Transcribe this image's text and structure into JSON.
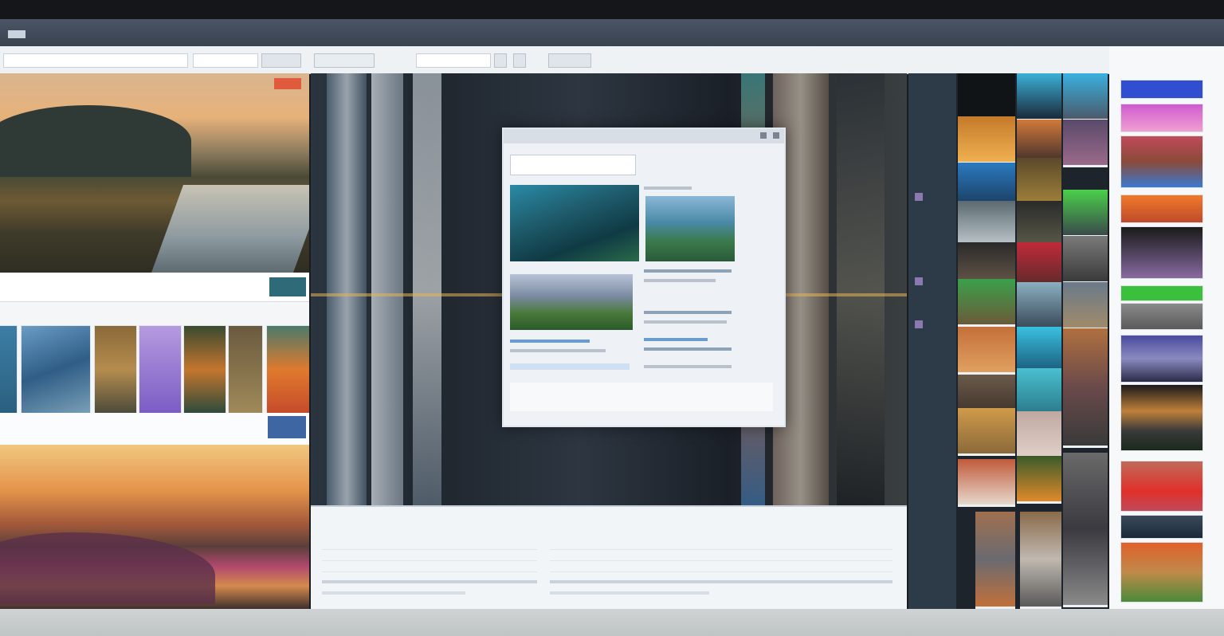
{
  "window": {
    "title": ""
  },
  "toolbar": {
    "path_value": "",
    "dropdown_value": "",
    "view_button": "",
    "tab_label": "",
    "tool_label": "",
    "zoom_label": ""
  },
  "left": {
    "hero_badge": "",
    "strip_option": "",
    "strip_button": "",
    "strip_label": "",
    "caption": ""
  },
  "dialog": {
    "title": "",
    "search_value": ""
  },
  "bottom": {
    "header": "",
    "header2": "",
    "rows": [
      "",
      "",
      "",
      "",
      "",
      ""
    ]
  },
  "right": {
    "header": "",
    "gallery_header": ""
  },
  "colors": {
    "accent_teal": "#2f6a78",
    "accent_blue": "#3d66a3",
    "badge_red": "#e05a3e",
    "gallery_highlight": "#2f4fd0"
  }
}
